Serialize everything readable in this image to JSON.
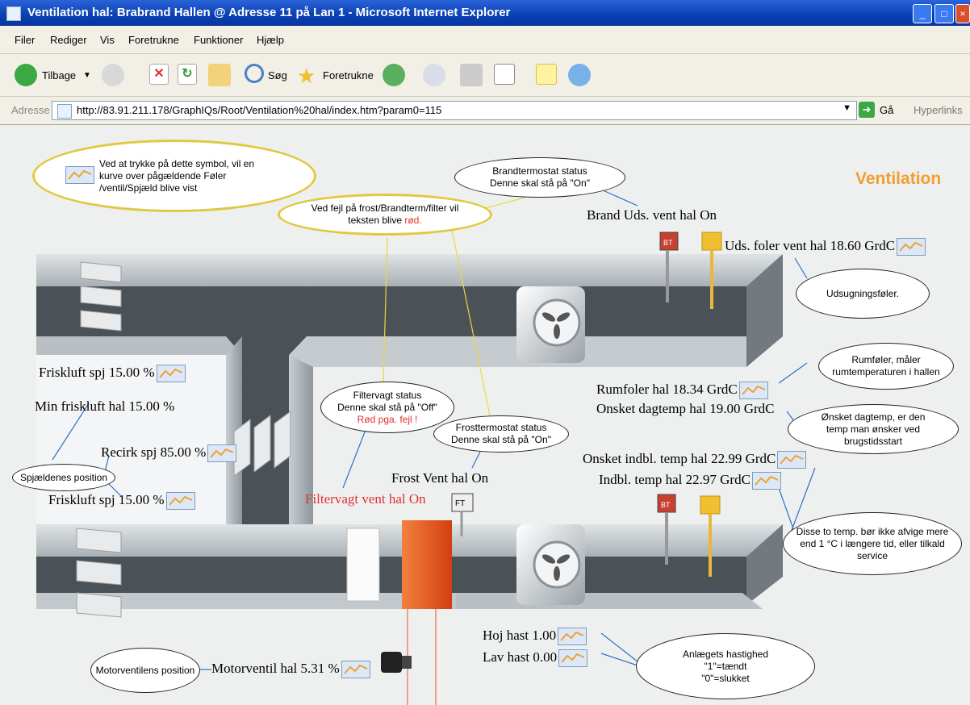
{
  "window": {
    "title": "Ventilation hal: Brabrand Hallen @ Adresse 11 på Lan 1 - Microsoft Internet Explorer"
  },
  "menu": [
    "Filer",
    "Rediger",
    "Vis",
    "Foretrukne",
    "Funktioner",
    "Hjælp"
  ],
  "toolbar": {
    "back": "Tilbage",
    "search": "Søg",
    "favorites": "Foretrukne"
  },
  "address": {
    "label": "Adresse",
    "url": "http://83.91.211.178/GraphIQs/Root/Ventilation%20hal/index.htm?param0=115",
    "go": "Gå",
    "links": "Hyperlinks"
  },
  "page": {
    "heading": "Ventilation",
    "brand_uds": "Brand Uds. vent hal On",
    "uds_foler": "Uds. foler vent hal 18.60 GrdC",
    "friskluft_top": "Friskluft spj 15.00 %",
    "min_friskluft": "Min friskluft hal 15.00 %",
    "recirk": "Recirk spj 85.00 %",
    "friskluft_bottom": "Friskluft spj 15.00 %",
    "frost_vent": "Frost Vent hal On",
    "filtervagt": "Filtervagt vent hal On",
    "rumfoler": "Rumfoler hal 18.34 GrdC",
    "onsket_dag": "Onsket dagtemp hal 19.00 GrdC",
    "onsket_indbl": "Onsket indbl. temp hal 22.99 GrdC",
    "indbl_temp": "Indbl. temp hal 22.97 GrdC",
    "hoj_hast": "Hoj hast 1.00",
    "lav_hast": "Lav hast 0.00",
    "motorventil": "Motorventil hal 5.31 %",
    "bt_label": "BT",
    "ft_label": "FT"
  },
  "notes": {
    "symbol_1": "Ved at trykke på dette symbol, vil en",
    "symbol_2": "kurve over pågældende Føler",
    "symbol_3": "/ventil/Spjæld blive vist",
    "fejl_1": "Ved fejl på frost/Brandterm/filter vil",
    "fejl_2a": "teksten blive ",
    "fejl_2b": "rød.",
    "brandterm_1": "Brandtermostat status",
    "brandterm_2": "Denne skal stå på \"On\"",
    "udsugning": "Udsugningsføler.",
    "rumfoler_1": "Rumføler, måler",
    "rumfoler_2": "rumtemperaturen i hallen",
    "onsket_1": "Ønsket dagtemp, er den",
    "onsket_2": "temp man ønsker ved",
    "onsket_3": "brugstidsstart",
    "filtervagt_1": "Filtervagt status",
    "filtervagt_2": "Denne skal stå på \"Off\"",
    "filtervagt_3": "Rød pga. fejl !",
    "frost_1": "Frosttermostat status",
    "frost_2": "Denne skal stå på \"On\"",
    "spjaeld": "Spjældenes position",
    "disse_1": "Disse to temp. bør ikke afvige mere",
    "disse_2": "end 1 °C i længere tid, eller tilkald",
    "disse_3": "service",
    "anlaeg_1": "Anlægets hastighed",
    "anlaeg_2": "\"1\"=tændt",
    "anlaeg_3": "\"0\"=slukket",
    "motorventil": "Motorventilens position"
  },
  "colors": {
    "titlebar": "#0a3fb4",
    "heading": "#f0a030",
    "alarm": "#e03030",
    "note_gold": "#e2c840",
    "heater": "#f06020"
  }
}
